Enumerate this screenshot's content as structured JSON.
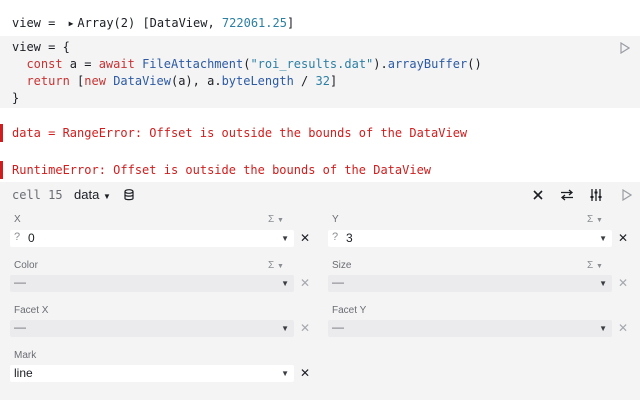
{
  "output": {
    "name": "view",
    "equals": " = ",
    "type": "Array(2)",
    "content_open": " [DataView, ",
    "value": "722061.25",
    "content_close": "]"
  },
  "code": {
    "line1": "view = {",
    "line2_pre": "  ",
    "kw_const": "const",
    "line2_a": " a = ",
    "kw_await": "await",
    "line2_sp": " ",
    "fn_fileattachment": "FileAttachment",
    "line2_p": "(",
    "str_file": "\"roi_results.dat\"",
    "line2_p2": ").",
    "fn_arraybuffer": "arrayBuffer",
    "line2_end": "()",
    "line3_pre": "  ",
    "kw_return": "return",
    "line3_b": " [",
    "kw_new": "new",
    "line3_sp": " ",
    "fn_dataview": "DataView",
    "line3_c": "(a), a.",
    "prop_bytelength": "byteLength",
    "line3_d": " / ",
    "num_32": "32",
    "line3_e": "]",
    "line4": "}"
  },
  "errors": {
    "data_error": "data = RangeError: Offset is outside the bounds of the DataView",
    "runtime_error": "RuntimeError: Offset is outside the bounds of the DataView"
  },
  "panel": {
    "cell_label": "cell 15",
    "data_select": "data",
    "fields": {
      "x": {
        "label": "X",
        "value": "0"
      },
      "y": {
        "label": "Y",
        "value": "3"
      },
      "color": {
        "label": "Color",
        "value": "—"
      },
      "size": {
        "label": "Size",
        "value": "—"
      },
      "facet_x": {
        "label": "Facet X",
        "value": "—"
      },
      "facet_y": {
        "label": "Facet Y",
        "value": "—"
      },
      "mark": {
        "label": "Mark",
        "value": "line"
      }
    },
    "sigma": "Σ",
    "question": "?",
    "caret": "▼",
    "clear": "✕"
  },
  "colors": {
    "error": "#d11d1d",
    "panel_bg": "#f4f4f5",
    "string": "#2c7fa3"
  }
}
